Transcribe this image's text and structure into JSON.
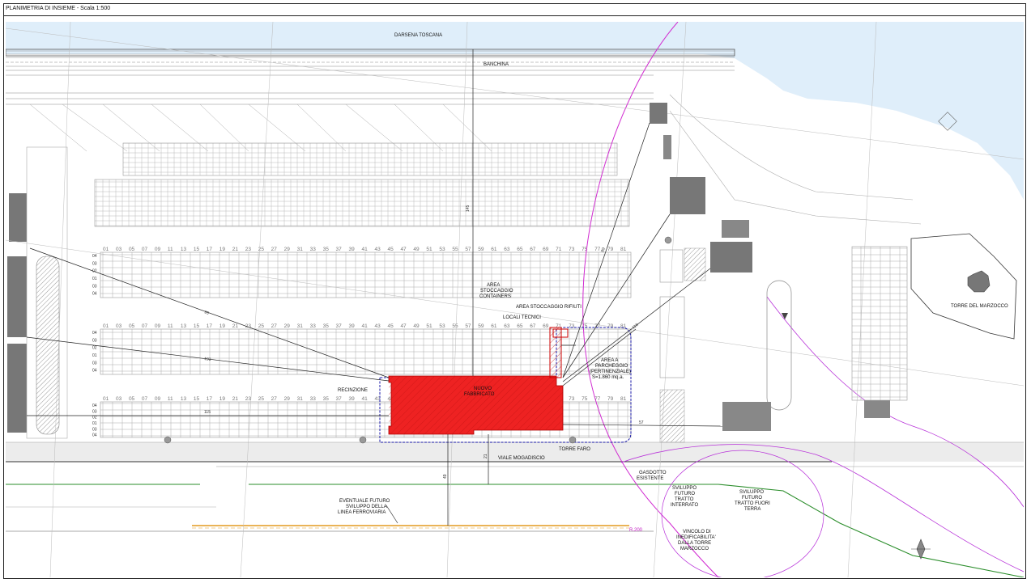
{
  "title": "PLANIMETRIA DI INSIEME - Scala 1:500",
  "labels": {
    "darsena": "DARSENA TOSCANA",
    "banchina": "BANCHINA",
    "area_stoccaggio_1": "AREA",
    "area_stoccaggio_2": "STOCCAGGIO",
    "area_stoccaggio_3": "CONTAINERS",
    "area_rifiuti": "AREA STOCCAGGIO RIFIUTI",
    "locali_tecnici": "LOCALI TECNICI",
    "parcheggio_1": "AREA A",
    "parcheggio_2": "PARCHEGGIO",
    "parcheggio_3": "(PERTINENZIALE)",
    "parcheggio_4": "S=1.860 mq.a.",
    "recinzione": "RECINZIONE",
    "nuovo_1": "NUOVO",
    "nuovo_2": "FABBRICATO",
    "torre_faro": "TORRE FARO",
    "viale": "VIALE MOGADISCIO",
    "gasdotto_1": "GASDOTTO",
    "gasdotto_2": "ESISTENTE",
    "ferrovia_1": "EVENTUALE FUTURO",
    "ferrovia_2": "SVILUPPO DELLA",
    "ferrovia_3": "LINEA FERROVIARIA",
    "sviluppo_int_1": "SVILUPPO",
    "sviluppo_int_2": "FUTURO",
    "sviluppo_int_3": "TRATTO",
    "sviluppo_int_4": "INTERRATO",
    "sviluppo_fuori_1": "SVILUPPO",
    "sviluppo_fuori_2": "FUTURO",
    "sviluppo_fuori_3": "TRATTO FUORI",
    "sviluppo_fuori_4": "TERRA",
    "vincolo_1": "VINCOLO DI",
    "vincolo_2": "INEDIFICABILITA'",
    "vincolo_3": "DALLA TORRE",
    "vincolo_4": "MARZOCCO",
    "torre_marzocco": "TORRE DEL MARZOCCO",
    "raggio": "R.200"
  },
  "bay_numbers": [
    "01",
    "03",
    "05",
    "07",
    "09",
    "11",
    "13",
    "15",
    "17",
    "19",
    "21",
    "23",
    "25",
    "27",
    "29",
    "31",
    "33",
    "35",
    "37",
    "39",
    "41",
    "43",
    "45",
    "47",
    "49",
    "51",
    "53",
    "55",
    "57",
    "59",
    "61",
    "63",
    "65",
    "67",
    "69",
    "71",
    "73",
    "75",
    "77",
    "79",
    "81"
  ],
  "row_numbers": [
    "04",
    "03",
    "02",
    "01",
    "03",
    "04"
  ],
  "dimensions": {
    "d1": "145",
    "d2": "95",
    "d3": "103",
    "d4": "115",
    "d5": "89",
    "d6": "118",
    "d7": "57",
    "d8": "21",
    "d9": "49"
  },
  "colors": {
    "sea": "#dfeefa",
    "building": "#ee2222",
    "magenta": "#d12cd1",
    "green": "#2a8d2a",
    "orange": "#e39a1f",
    "blue_dash": "#1a1aa8",
    "line": "#9a9a9a",
    "road": "#ececec"
  }
}
